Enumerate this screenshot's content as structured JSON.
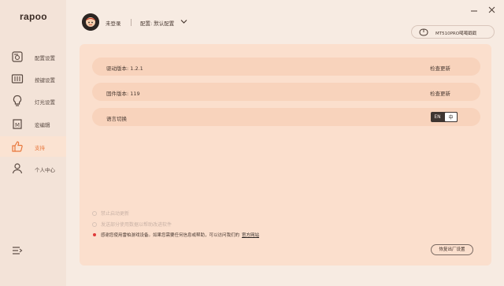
{
  "brand": {
    "logo": "rapoo"
  },
  "sidebar": {
    "items": [
      {
        "label": "配置设置",
        "icon": "config-settings-icon"
      },
      {
        "label": "按键设置",
        "icon": "key-settings-icon"
      },
      {
        "label": "灯光设置",
        "icon": "lightbulb-icon"
      },
      {
        "label": "宏编辑",
        "icon": "macro-edit-icon"
      },
      {
        "label": "支持",
        "icon": "thumbs-up-icon",
        "active": true
      },
      {
        "label": "个人中心",
        "icon": "user-icon"
      }
    ]
  },
  "header": {
    "login_status": "未登录",
    "config_label": "配置: 默认配置",
    "device_name": "MT510PRO噶噶戳戳"
  },
  "support": {
    "driver_version": "驱动版本: 1.2.1",
    "driver_action": "检查更新",
    "firmware_version": "固件版本: 119",
    "firmware_action": "检查更新",
    "language_label": "语言切换",
    "lang_en": "EN",
    "lang_zh": "中",
    "option_disable_autoupdate": "禁止启动更新",
    "option_send_data": "发送部分使用数据以帮助改进软件",
    "notice_text": "感谢您使用雷柏游戏设备。如果您需要任何信息或帮助，可以访问我们的",
    "notice_link": "官方网站",
    "reset_button": "恢复出厂设置"
  },
  "colors": {
    "accent": "#e8773c",
    "panel": "#fbdfcd",
    "row": "#f8d3bc",
    "notice_dot": "#e03a3a"
  }
}
